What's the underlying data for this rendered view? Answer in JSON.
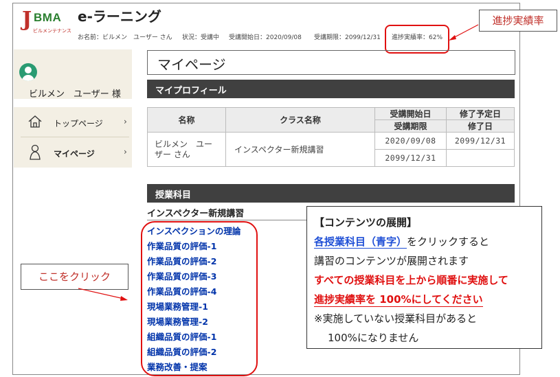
{
  "header": {
    "logo_letter": "J",
    "logo_text": "BMA",
    "logo_sub": "ビルメンテナンス",
    "app_title": "e-ラーニング",
    "user_label": "お名前：ビルメン　ユーザー さん",
    "status_label": "状況：受講中",
    "start_label": "受講開始日：2020/09/08",
    "expiry_label": "受講期限：2099/12/31",
    "progress_label": "進捗実績率：62%"
  },
  "annotations": {
    "progress_callout": "進捗実績率",
    "click_callout": "ここをクリック"
  },
  "sidebar": {
    "user_name": "ビルメン　ユーザー 様",
    "items": [
      {
        "label": "トップページ",
        "icon": "home-icon"
      },
      {
        "label": "マイページ",
        "icon": "person-icon"
      }
    ]
  },
  "main": {
    "page_title": "マイページ",
    "profile_heading": "マイプロフィール",
    "profile_table": {
      "headers": {
        "name": "名称",
        "class": "クラス名称",
        "start": "受講開始日",
        "period": "受講期限",
        "planned": "修了予定日",
        "completed": "修了日"
      },
      "row": {
        "name": "ビルメン　ユーザー さん",
        "class": "インスペクター新規講習",
        "start": "2020/09/08",
        "period": "2099/12/31",
        "planned": "2099/12/31",
        "completed": ""
      }
    },
    "subjects_heading": "授業科目",
    "course_name": "インスペクター新規講習",
    "subjects": [
      "インスペクションの理論",
      "作業品質の評価-1",
      "作業品質の評価-2",
      "作業品質の評価-3",
      "作業品質の評価-4",
      "現場業務管理-1",
      "現場業務管理-2",
      "組織品質の評価-1",
      "組織品質の評価-2",
      "業務改善・提案"
    ]
  },
  "explanation": {
    "title": "【コンテンツの展開】",
    "line1_link": "各授業科目（青字）",
    "line1_rest": "をクリックすると",
    "line2": "講習のコンテンツが展開されます",
    "line3": "すべての授業科目を上から順番に実施して",
    "line4": "進捗実績率を 100%にしてください",
    "line5": "※実施していない授業科目があると",
    "line6": "100%になりません"
  },
  "colors": {
    "link_blue": "#0033aa",
    "alert_red": "#e01010",
    "section_bar": "#404040",
    "sidebar_bg": "#f3efe4"
  }
}
